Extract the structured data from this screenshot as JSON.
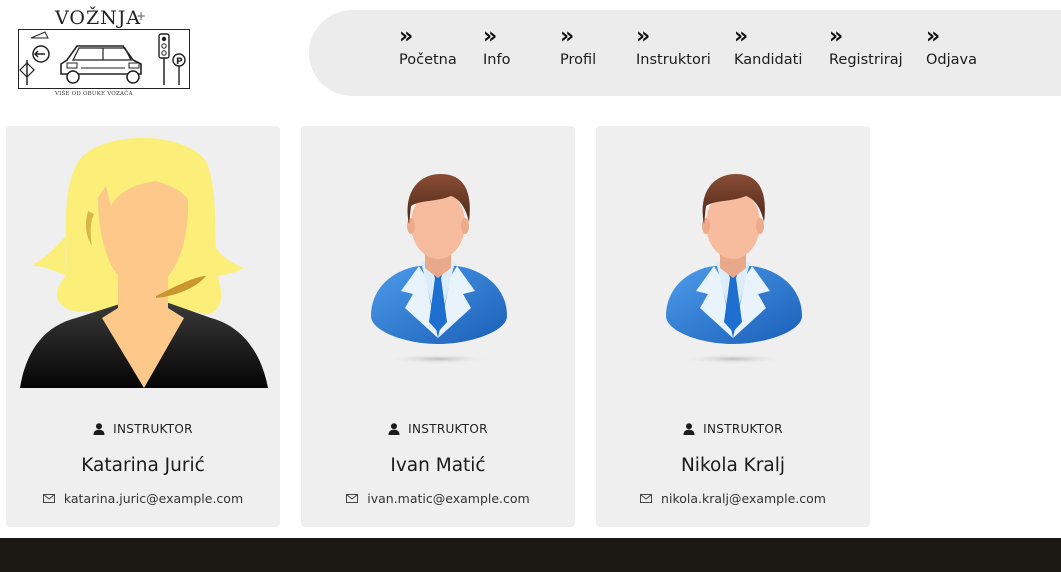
{
  "logo": {
    "title": "VOŽNJA",
    "plus": "+",
    "tagline": "VIŠE OD OBUKE VOZAČA"
  },
  "nav": {
    "items": [
      {
        "label": "Početna",
        "icon": "double-chevron-right-icon"
      },
      {
        "label": "Info",
        "icon": "double-chevron-right-icon"
      },
      {
        "label": "Profil",
        "icon": "double-chevron-right-icon"
      },
      {
        "label": "Instruktori",
        "icon": "double-chevron-right-icon"
      },
      {
        "label": "Kandidati",
        "icon": "double-chevron-right-icon"
      },
      {
        "label": "Registriraj",
        "icon": "double-chevron-right-icon"
      },
      {
        "label": "Odjava",
        "icon": "double-chevron-right-icon"
      }
    ],
    "chevron": "»"
  },
  "instructors": [
    {
      "role": "INSTRUKTOR",
      "name": "Katarina Jurić",
      "email": "katarina.juric@example.com",
      "avatar": "female-avatar"
    },
    {
      "role": "INSTRUKTOR",
      "name": "Ivan Matić",
      "email": "ivan.matic@example.com",
      "avatar": "male-avatar"
    },
    {
      "role": "INSTRUKTOR",
      "name": "Nikola Kralj",
      "email": "nikola.kralj@example.com",
      "avatar": "male-avatar"
    }
  ],
  "colors": {
    "nav_bg": "#ececec",
    "card_bg": "#efefef",
    "footer_bg": "#1a1813",
    "suit_blue": "#2a7bd6",
    "hair_blonde": "#fbef7a"
  }
}
